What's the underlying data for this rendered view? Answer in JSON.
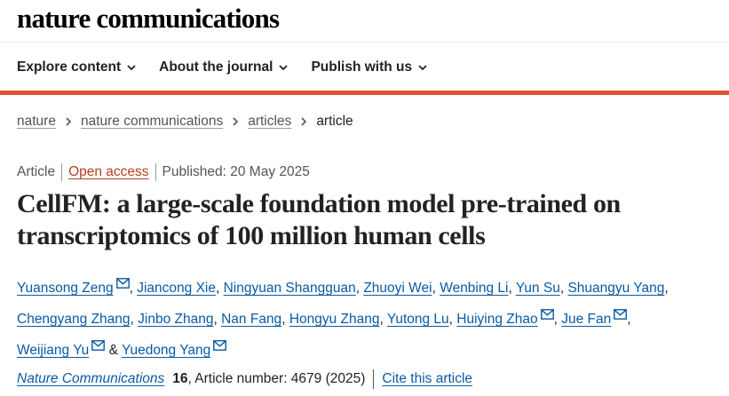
{
  "masthead": {
    "brand": "nature communications"
  },
  "nav": {
    "items": [
      {
        "label": "Explore content"
      },
      {
        "label": "About the journal"
      },
      {
        "label": "Publish with us"
      }
    ]
  },
  "breadcrumb": {
    "links": [
      "nature",
      "nature communications",
      "articles"
    ],
    "current": "article"
  },
  "article": {
    "type": "Article",
    "access": "Open access",
    "published": "Published: 20 May 2025",
    "title": "CellFM: a large-scale foundation model pre-trained on transcriptomics of 100 million human cells",
    "authors": [
      {
        "name": "Yuansong Zeng",
        "email": true
      },
      {
        "name": "Jiancong Xie",
        "email": false
      },
      {
        "name": "Ningyuan Shangguan",
        "email": false
      },
      {
        "name": "Zhuoyi Wei",
        "email": false
      },
      {
        "name": "Wenbing Li",
        "email": false
      },
      {
        "name": "Yun Su",
        "email": false
      },
      {
        "name": "Shuangyu Yang",
        "email": false
      },
      {
        "name": "Chengyang Zhang",
        "email": false
      },
      {
        "name": "Jinbo Zhang",
        "email": false
      },
      {
        "name": "Nan Fang",
        "email": false
      },
      {
        "name": "Hongyu Zhang",
        "email": false
      },
      {
        "name": "Yutong Lu",
        "email": false
      },
      {
        "name": "Huiying Zhao",
        "email": true
      },
      {
        "name": "Jue Fan",
        "email": true
      },
      {
        "name": "Weijiang Yu",
        "email": true
      },
      {
        "name": "Yuedong Yang",
        "email": true
      }
    ],
    "author_sep": ", ",
    "author_last_sep": " & ",
    "author_line_end": ","
  },
  "citation": {
    "journal": "Nature Communications",
    "volume": "16",
    "details": ", Article number: 4679 (2025)",
    "cite_label": "Cite this article"
  },
  "colors": {
    "accent_bar": "#e04e39",
    "link": "#0a5aa4",
    "open_access": "#b5401e"
  }
}
